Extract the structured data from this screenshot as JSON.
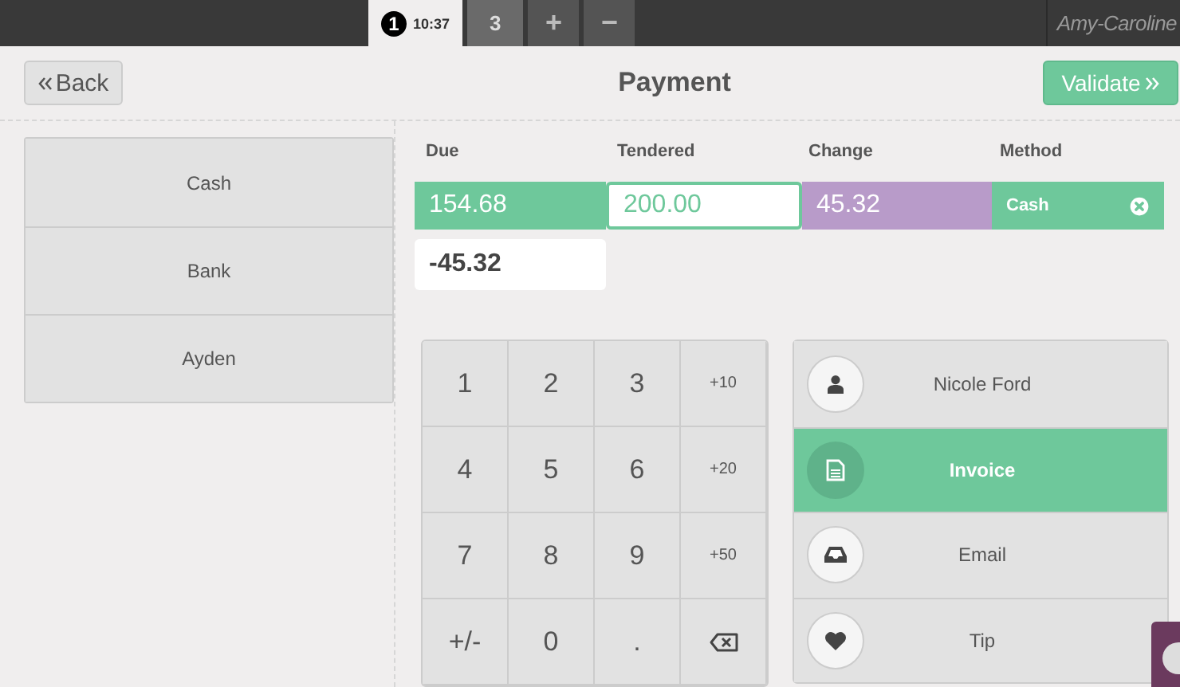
{
  "topbar": {
    "order_tabs": [
      {
        "kind": "order",
        "badge": "1",
        "label": "10:37",
        "selected": true
      },
      {
        "kind": "order",
        "label": "3",
        "selected": false
      },
      {
        "kind": "add",
        "label": "+",
        "selected": false
      },
      {
        "kind": "remove",
        "label": "−",
        "selected": false
      }
    ],
    "user": "Amy-Caroline"
  },
  "header": {
    "back": "Back",
    "title": "Payment",
    "validate": "Validate"
  },
  "payment_methods": [
    "Cash",
    "Bank",
    "Ayden"
  ],
  "lines": {
    "columns": [
      "Due",
      "Tendered",
      "Change",
      "Method"
    ],
    "row": {
      "due": "154.68",
      "tendered": "200.00",
      "change": "45.32",
      "method": "Cash"
    },
    "remaining": "-45.32"
  },
  "numpad": [
    {
      "kind": "digit",
      "label": "1"
    },
    {
      "kind": "digit",
      "label": "2"
    },
    {
      "kind": "digit",
      "label": "3"
    },
    {
      "kind": "quick",
      "label": "+10"
    },
    {
      "kind": "digit",
      "label": "4"
    },
    {
      "kind": "digit",
      "label": "5"
    },
    {
      "kind": "digit",
      "label": "6"
    },
    {
      "kind": "quick",
      "label": "+20"
    },
    {
      "kind": "digit",
      "label": "7"
    },
    {
      "kind": "digit",
      "label": "8"
    },
    {
      "kind": "digit",
      "label": "9"
    },
    {
      "kind": "quick",
      "label": "+50"
    },
    {
      "kind": "digit",
      "label": "+/-"
    },
    {
      "kind": "digit",
      "label": "0"
    },
    {
      "kind": "digit",
      "label": "."
    },
    {
      "kind": "backspace"
    }
  ],
  "options": [
    {
      "kind": "customer",
      "label": "Nicole Ford",
      "selected": false
    },
    {
      "kind": "invoice",
      "label": "Invoice",
      "selected": true
    },
    {
      "kind": "email",
      "label": "Email",
      "selected": false
    },
    {
      "kind": "tip",
      "label": "Tip",
      "selected": false
    }
  ]
}
